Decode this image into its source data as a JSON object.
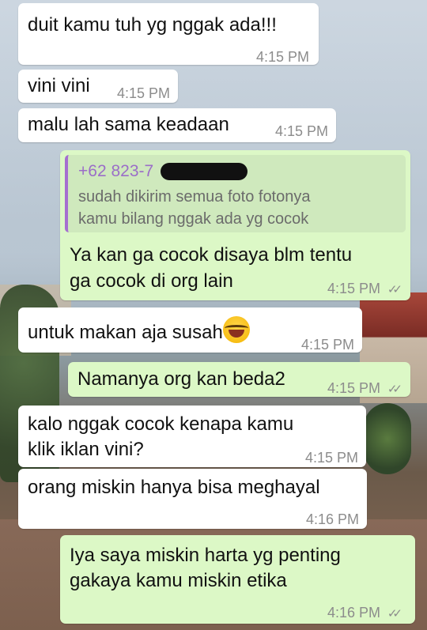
{
  "messages": [
    {
      "text": "duit kamu tuh yg nggak ada!!!",
      "time": "4:15 PM"
    },
    {
      "text": "vini vini",
      "time": "4:15 PM"
    },
    {
      "text": "malu lah sama keadaan",
      "time": "4:15 PM"
    },
    {
      "quote_name": "+62 823-7",
      "quote_line1": "sudah dikirim semua foto fotonya",
      "quote_line2": "kamu bilang nggak ada yg cocok",
      "line1": "Ya kan ga cocok disaya blm tentu",
      "line2": "ga cocok di org lain",
      "time": "4:15 PM",
      "ticks": "✓✓"
    },
    {
      "text": "untuk makan aja susah",
      "time": "4:15 PM"
    },
    {
      "text": "Namanya org kan beda2",
      "time": "4:15 PM",
      "ticks": "✓✓"
    },
    {
      "line1": "kalo nggak cocok kenapa kamu",
      "line2": "klik iklan vini?",
      "time": "4:15 PM"
    },
    {
      "text": "orang miskin hanya bisa meghayal",
      "time": "4:16 PM"
    },
    {
      "line1": "Iya saya miskin harta yg penting",
      "line2": "gakaya kamu miskin etika",
      "time": "4:16 PM",
      "ticks": "✓✓"
    }
  ]
}
